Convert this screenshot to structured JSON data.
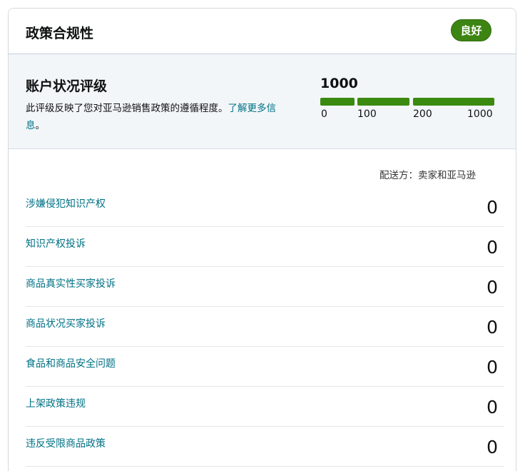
{
  "header": {
    "title": "政策合规性",
    "status_badge": "良好",
    "badge_color": "#3d8513"
  },
  "account_health": {
    "title": "账户状况评级",
    "description": "此评级反映了您对亚马逊销售政策的遵循程度。",
    "learn_more_link": "了解更多信息",
    "trailing_period": "。",
    "score": "1000",
    "score_level": 1.0,
    "bar_color": "#3a8a10",
    "ticks": [
      "0",
      "100",
      "200",
      "1000"
    ]
  },
  "fulfillment_label": "配送方：卖家和亚马逊",
  "metrics": [
    {
      "label": "涉嫌侵犯知识产权",
      "value": "0"
    },
    {
      "label": "知识产权投诉",
      "value": "0"
    },
    {
      "label": "商品真实性买家投诉",
      "value": "0"
    },
    {
      "label": "商品状况买家投诉",
      "value": "0"
    },
    {
      "label": "食品和商品安全问题",
      "value": "0"
    },
    {
      "label": "上架政策违规",
      "value": "0"
    },
    {
      "label": "违反受限商品政策",
      "value": "0"
    }
  ]
}
